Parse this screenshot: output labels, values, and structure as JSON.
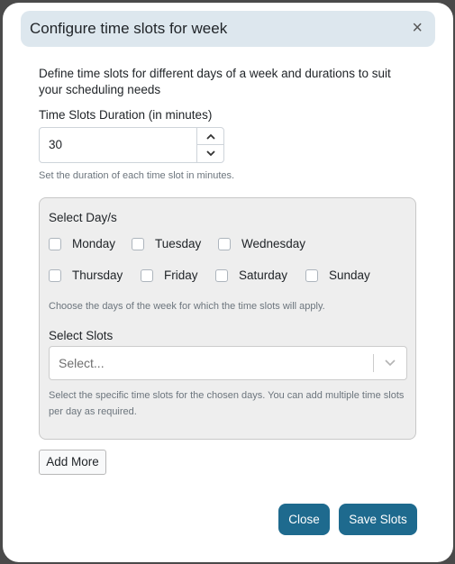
{
  "modal": {
    "title": "Configure time slots for week",
    "close_icon": "×",
    "description": "Define time slots for different days of a week and durations to suit your scheduling needs"
  },
  "duration": {
    "label": "Time Slots Duration (in minutes)",
    "value": "30",
    "up_icon": "⌃",
    "down_icon": "⌄",
    "help": "Set the duration of each time slot in minutes."
  },
  "days": {
    "label": "Select Day/s",
    "items": [
      {
        "label": "Monday",
        "checked": false
      },
      {
        "label": "Tuesday",
        "checked": false
      },
      {
        "label": "Wednesday",
        "checked": false
      },
      {
        "label": "Thursday",
        "checked": false
      },
      {
        "label": "Friday",
        "checked": false
      },
      {
        "label": "Saturday",
        "checked": false
      },
      {
        "label": "Sunday",
        "checked": false
      }
    ],
    "help": "Choose the days of the week for which the time slots will apply."
  },
  "slots": {
    "label": "Select Slots",
    "placeholder": "Select...",
    "chevron_icon": "⌄",
    "help": "Select the specific time slots for the chosen days. You can add multiple time slots per day as required."
  },
  "actions": {
    "add_more": "Add More",
    "close": "Close",
    "save": "Save Slots"
  },
  "colors": {
    "primary": "#1e6a8e",
    "header_bg": "#dde7ee",
    "panel_bg": "#eeeeee"
  }
}
